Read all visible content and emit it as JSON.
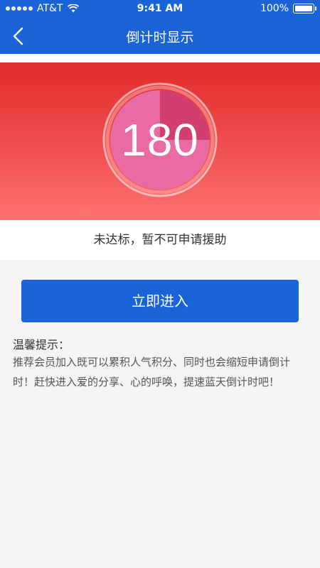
{
  "status_bar": {
    "carrier": "AT&T",
    "time": "9:41 AM",
    "battery_percent": "100%"
  },
  "nav": {
    "title": "倒计时显示",
    "back_icon": "chevron-left-icon"
  },
  "countdown": {
    "value": "180",
    "progress_fraction": 0.25
  },
  "notice": "未达标，暂不可申请援助",
  "cta": {
    "label": "立即进入"
  },
  "tips": {
    "title": "温馨提示：",
    "body": "推荐会员加入既可以累积人气积分、同时也会缩短申请倒计时！赶快进入爱的分享、心的呼唤，提速蓝天倒计时吧！"
  },
  "colors": {
    "primary_blue": "#1a63d9",
    "hero_red": "#e22b2b",
    "ring_pink": "#f07ab0"
  }
}
